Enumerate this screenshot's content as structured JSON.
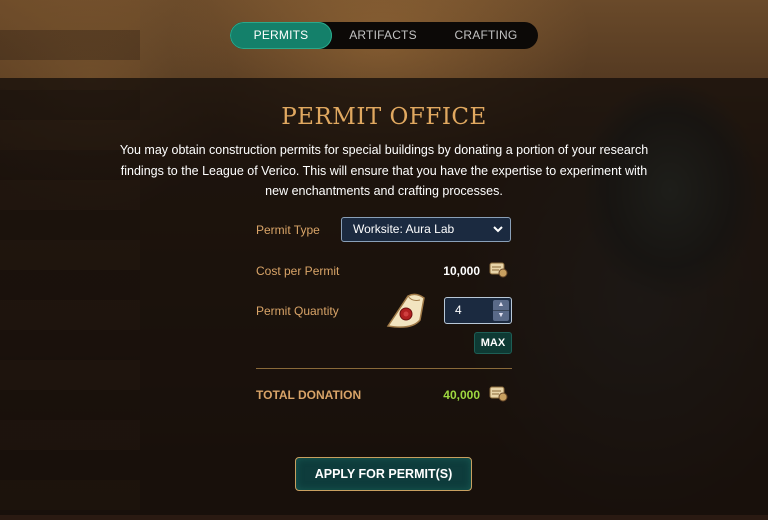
{
  "tabs": [
    {
      "label": "PERMITS",
      "active": true
    },
    {
      "label": "ARTIFACTS",
      "active": false
    },
    {
      "label": "CRAFTING",
      "active": false
    }
  ],
  "title": "PERMIT OFFICE",
  "description": "You may obtain construction permits for special buildings by donating a portion of your research findings to the League of Verico. This will ensure that you have the expertise to experiment with new enchantments and crafting processes.",
  "form": {
    "permit_type_label": "Permit Type",
    "permit_type_value": "Worksite: Aura Lab",
    "cost_label": "Cost per Permit",
    "cost_value": "10,000",
    "quantity_label": "Permit Quantity",
    "quantity_value": "4",
    "max_label": "MAX"
  },
  "total": {
    "label": "TOTAL DONATION",
    "value": "40,000"
  },
  "apply_label": "APPLY FOR PERMIT(S)",
  "colors": {
    "accent": "#14806a",
    "title": "#e0a860",
    "label": "#d9a468",
    "total": "#9ed840"
  },
  "icons": {
    "currency": "research-scroll-icon",
    "permit": "permit-scroll-icon"
  }
}
